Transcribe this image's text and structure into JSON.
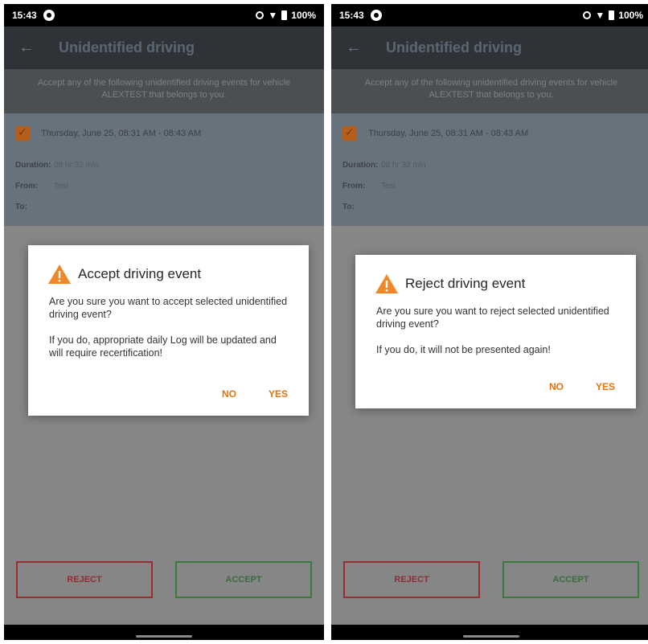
{
  "status_bar": {
    "time": "15:43",
    "battery": "100%"
  },
  "app_bar": {
    "title": "Unidentified driving"
  },
  "banner": {
    "text": "Accept any of the following unidentified driving events for vehicle ALEXTEST that belongs to you."
  },
  "event": {
    "title": "Thursday, June 25, 08:31 AM - 08:43 AM",
    "duration_label": "Duration:",
    "duration_value": "08 hr 32 min",
    "from_label": "From:",
    "from_value": "Test",
    "to_label": "To:",
    "to_value": ""
  },
  "buttons": {
    "reject": "REJECT",
    "accept": "ACCEPT"
  },
  "dialog_accept": {
    "title": "Accept driving event",
    "message1": "Are you sure you want to accept selected unidentified driving event?",
    "message2": "If you do, appropriate daily Log will be updated and will require recertification!",
    "no": "NO",
    "yes": "YES"
  },
  "dialog_reject": {
    "title": "Reject driving event",
    "message1": "Are you sure you want to reject selected unidentified driving event?",
    "message2": "If you do, it will not be presented again!",
    "no": "NO",
    "yes": "YES"
  },
  "colors": {
    "accent": "#e8730c",
    "reject": "#9b2d31",
    "accept": "#3a7a3a"
  },
  "icons": {
    "back": "back-arrow-icon",
    "warning": "warning-icon",
    "check": "checkbox-checked-icon"
  }
}
